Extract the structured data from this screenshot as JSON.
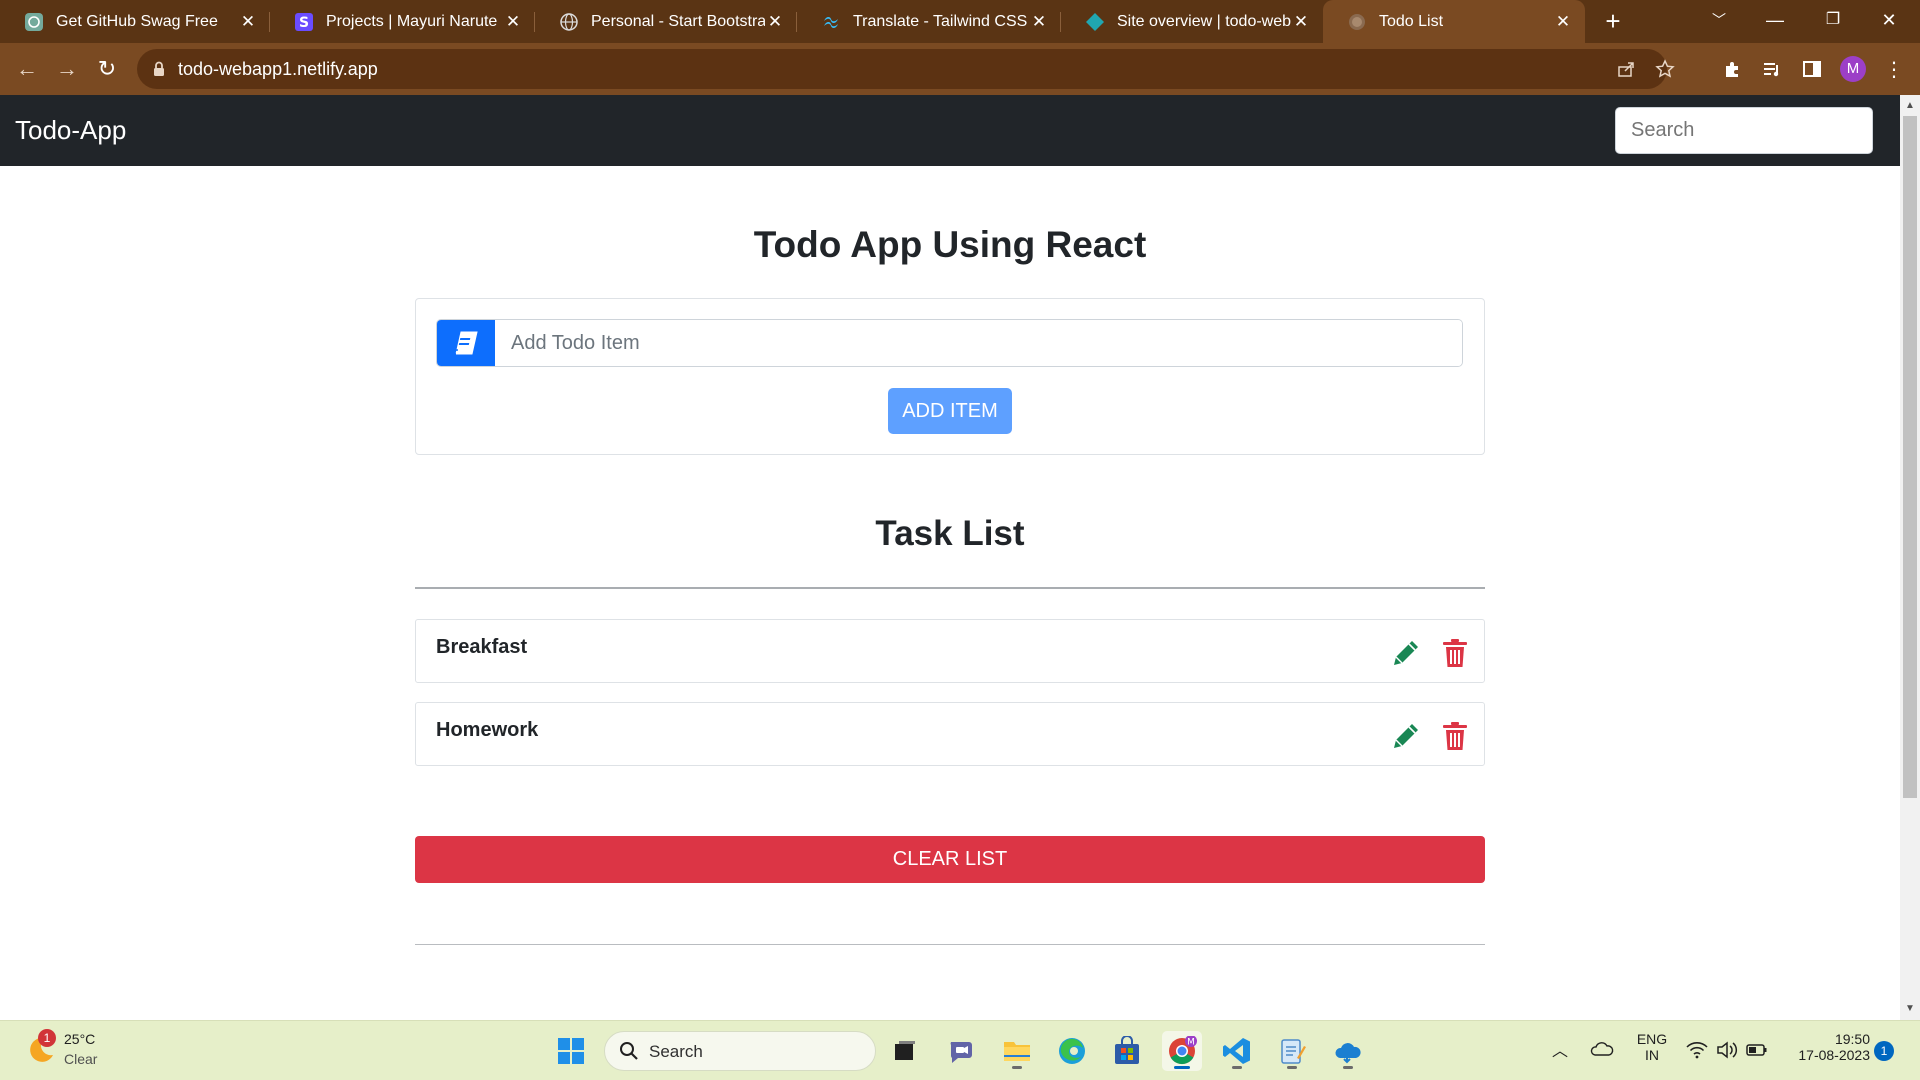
{
  "browser": {
    "tabs": [
      {
        "title": "Get GitHub Swag Free",
        "icon": "openai-icon"
      },
      {
        "title": "Projects | Mayuri Narute",
        "icon": "s-logo-icon"
      },
      {
        "title": "Personal - Start Bootstrap T",
        "icon": "globe-icon"
      },
      {
        "title": "Translate - Tailwind CSS",
        "icon": "tailwind-icon"
      },
      {
        "title": "Site overview | todo-webap",
        "icon": "netlify-icon"
      },
      {
        "title": "Todo List",
        "icon": "globe-icon",
        "active": true
      }
    ],
    "new_tab_label": "+",
    "url": "todo-webapp1.netlify.app",
    "profile_initial": "M"
  },
  "app": {
    "brand": "Todo-App",
    "search_placeholder": "Search",
    "main_title": "Todo App Using React",
    "input_placeholder": "Add Todo Item",
    "add_button": "ADD ITEM",
    "task_list_title": "Task List",
    "tasks": [
      {
        "text": "Breakfast"
      },
      {
        "text": "Homework"
      }
    ],
    "clear_button": "CLEAR LIST"
  },
  "colors": {
    "navbar": "#212529",
    "add_button": "#5ea0ff",
    "clear_button": "#dc3545",
    "edit_icon": "#198754",
    "delete_icon": "#dc3545",
    "input_icon_bg": "#0d6efd"
  },
  "taskbar": {
    "weather_badge": "1",
    "weather_temp": "25°C",
    "weather_cond": "Clear",
    "search_label": "Search",
    "lang_line1": "ENG",
    "lang_line2": "IN",
    "time": "19:50",
    "date": "17-08-2023",
    "notification_count": "1"
  }
}
